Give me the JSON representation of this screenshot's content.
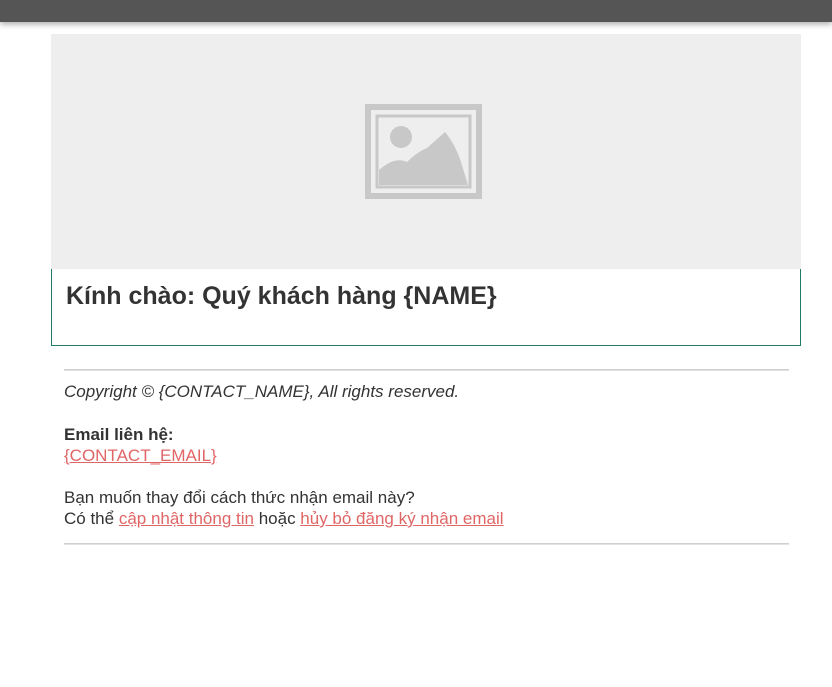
{
  "email": {
    "greeting": "Kính chào: Quý khách hàng {NAME}",
    "hero_image_icon": "image-placeholder-icon"
  },
  "footer": {
    "copyright": "Copyright © {CONTACT_NAME}, All rights reserved.",
    "contact_label": "Email liên hệ:",
    "contact_email": "{CONTACT_EMAIL}",
    "change_question": "Bạn muốn thay đổi cách thức nhận email này?",
    "change_prefix": "Có thể ",
    "update_link": "cập nhật thông tin",
    "conjunction": " hoặc ",
    "unsubscribe_link": "hủy bỏ đăng ký nhận email"
  },
  "colors": {
    "topbar": "#555555",
    "card_border": "#1f7a6a",
    "hero_bg": "#efeeee",
    "link": "#e06666",
    "text": "#333333"
  }
}
